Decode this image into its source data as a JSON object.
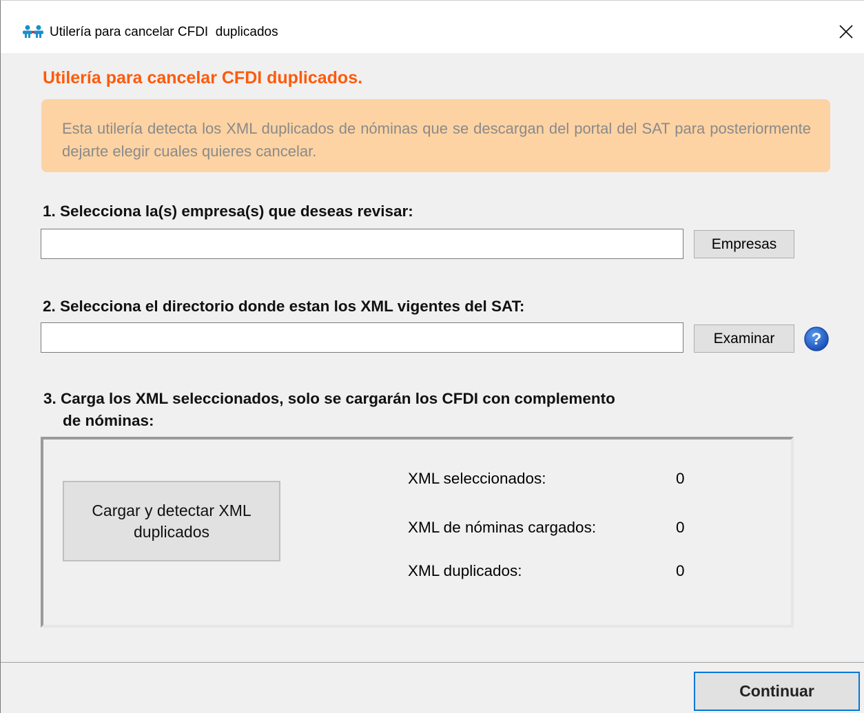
{
  "window": {
    "title": "Utilería para cancelar CFDI  duplicados",
    "app_icon": "users-icon",
    "close_icon": "close-icon"
  },
  "heading": "Utilería para cancelar CFDI duplicados.",
  "info": {
    "text": "Esta utilería detecta los XML duplicados de nóminas que se descargan del portal del SAT para posteriormente dejarte elegir cuales quieres cancelar."
  },
  "step1": {
    "label": "1. Selecciona la(s) empresa(s) que deseas revisar:",
    "input_value": "",
    "button_label": "Empresas"
  },
  "step2": {
    "label": "2. Selecciona el directorio donde estan los XML vigentes del SAT:",
    "input_value": "",
    "button_label": "Examinar",
    "help_icon": "help-icon"
  },
  "step3": {
    "label_line1": "3. Carga los XML seleccionados, solo se cargarán los CFDI con complemento",
    "label_line2": "de nóminas:",
    "load_button_label": "Cargar y detectar XML duplicados",
    "stats": [
      {
        "label": "XML seleccionados:",
        "value": "0"
      },
      {
        "label": "XML de nóminas cargados:",
        "value": "0"
      },
      {
        "label": "XML duplicados:",
        "value": "0"
      }
    ]
  },
  "footer": {
    "continue_label": "Continuar"
  },
  "colors": {
    "heading": "#ff5a0a",
    "info_background": "#fdd3a3",
    "info_text": "#8a8a8a",
    "window_background": "#f0f0f0",
    "focus_border": "#0078d7",
    "help_icon": "#1e5cc7"
  }
}
